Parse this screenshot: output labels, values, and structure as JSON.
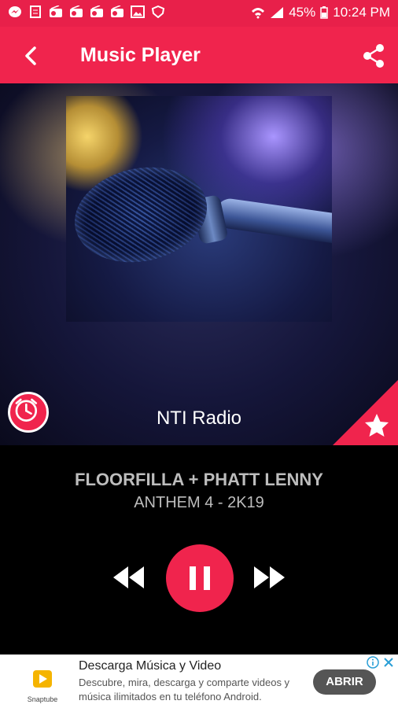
{
  "status_bar": {
    "battery": "45%",
    "time": "10:24 PM",
    "icons": [
      "messenger-icon",
      "ballot-icon",
      "radio-icon",
      "radio-icon",
      "radio-icon",
      "radio-icon",
      "image-icon",
      "shield-icon",
      "wifi-icon",
      "signal-icon",
      "battery-icon"
    ]
  },
  "app_bar": {
    "title": "Music Player",
    "icons": [
      "back-arrow-icon",
      "share-icon"
    ]
  },
  "player": {
    "station": "NTI Radio",
    "song_title": "FLOORFILLA + PHATT LENNY",
    "artist": "ANTHEM 4 - 2K19",
    "state": "playing",
    "controls": [
      "rewind-icon",
      "pause-icon",
      "fast-forward-icon"
    ],
    "side_buttons": [
      "alarm-clock-icon",
      "star-icon"
    ]
  },
  "ad": {
    "logo_label": "Snaptube",
    "title": "Descarga Música y Video",
    "description": "Descubre, mira, descarga y comparte videos y música ilimitados en tu teléfono Android.",
    "button": "ABRIR",
    "icons": [
      "info-icon",
      "close-icon"
    ]
  },
  "colors": {
    "accent": "#f0244d",
    "status_bar": "#e8204a",
    "player_bg": "#000000",
    "text_grey": "#bdbdbd"
  }
}
